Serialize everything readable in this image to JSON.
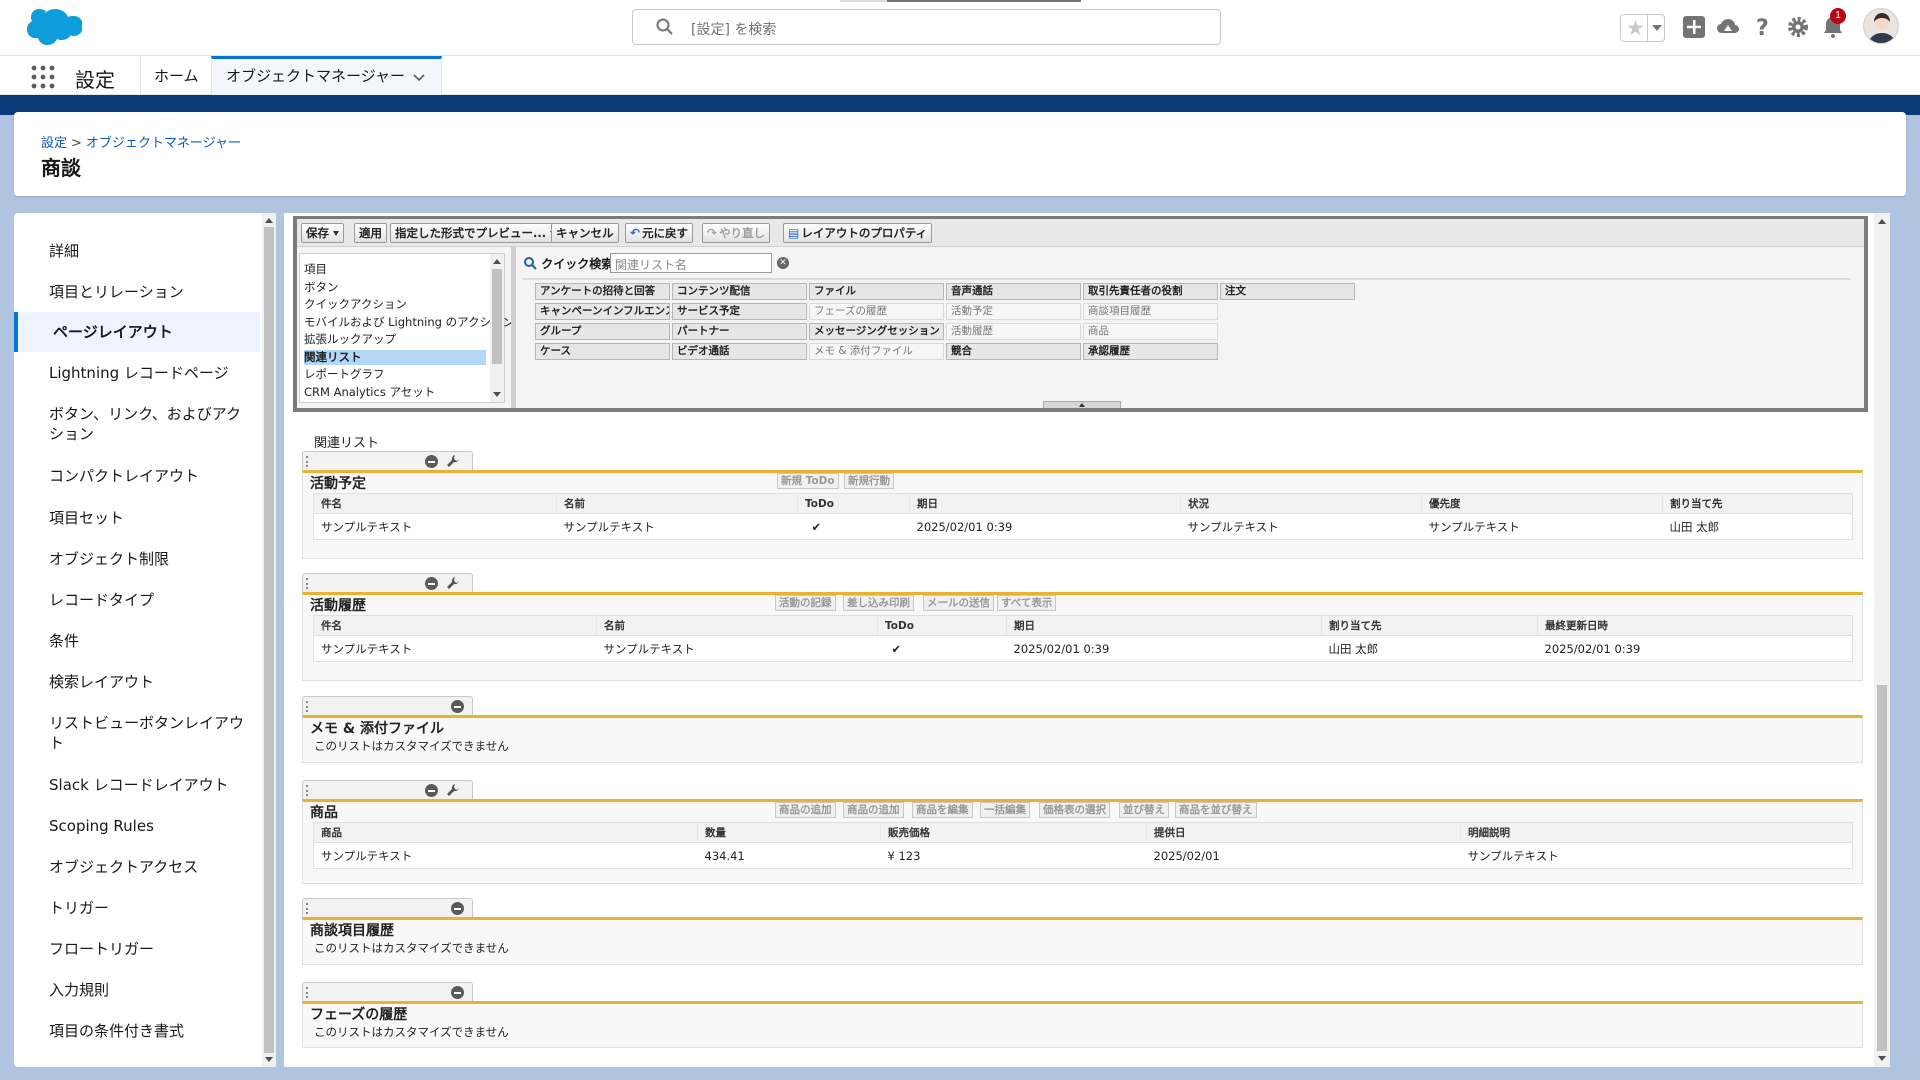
{
  "header": {
    "search_placeholder": "[設定] を検索",
    "notification_count": "1",
    "icons": [
      "favorites-star-icon",
      "favorites-list-icon",
      "global-add-icon",
      "trailhead-icon",
      "help-icon",
      "setup-gear-icon",
      "notifications-bell-icon",
      "user-avatar"
    ]
  },
  "nav": {
    "app_title": "設定",
    "tabs": [
      {
        "label": "ホーム"
      },
      {
        "label": "オブジェクトマネージャー",
        "active": true
      }
    ]
  },
  "page": {
    "breadcrumb": [
      "設定",
      "オブジェクトマネージャー"
    ],
    "breadcrumb_sep": ">",
    "title": "商談"
  },
  "sidebar": {
    "items": [
      {
        "label": "詳細"
      },
      {
        "label": "項目とリレーション"
      },
      {
        "label": "ページレイアウト",
        "active": true
      },
      {
        "label": "Lightning レコードページ"
      },
      {
        "label": "ボタン、リンク、およびアクション"
      },
      {
        "label": "コンパクトレイアウト"
      },
      {
        "label": "項目セット"
      },
      {
        "label": "オブジェクト制限"
      },
      {
        "label": "レコードタイプ"
      },
      {
        "label": "条件"
      },
      {
        "label": "検索レイアウト"
      },
      {
        "label": "リストビューボタンレイアウト"
      },
      {
        "label": "Slack レコードレイアウト"
      },
      {
        "label": "Scoping Rules"
      },
      {
        "label": "オブジェクトアクセス"
      },
      {
        "label": "トリガー"
      },
      {
        "label": "フロートリガー"
      },
      {
        "label": "入力規則"
      },
      {
        "label": "項目の条件付き書式"
      }
    ]
  },
  "toolbar": {
    "save": "保存",
    "apply": "適用",
    "preview": "指定した形式でプレビュー...",
    "cancel": "キャンセル",
    "undo": "元に戻す",
    "redo": "やり直し",
    "layout_props": "レイアウトのプロパティ"
  },
  "palette": {
    "categories": [
      {
        "label": "項目"
      },
      {
        "label": "ボタン"
      },
      {
        "label": "クイックアクション"
      },
      {
        "label": "モバイルおよび Lightning のアクション"
      },
      {
        "label": "拡張ルックアップ"
      },
      {
        "label": "関連リスト",
        "selected": true
      },
      {
        "label": "レポートグラフ"
      },
      {
        "label": "CRM Analytics アセット"
      }
    ],
    "quick_search_label": "クイック検索",
    "quick_search_placeholder": "関連リスト名",
    "fields": [
      [
        {
          "label": "アンケートの招待と回答"
        },
        {
          "label": "コンテンツ配信"
        },
        {
          "label": "ファイル"
        },
        {
          "label": "音声通話"
        },
        {
          "label": "取引先責任者の役割"
        },
        {
          "label": "注文"
        }
      ],
      [
        {
          "label": "キャンペーンインフルエンス"
        },
        {
          "label": "サービス予定"
        },
        {
          "label": "フェーズの履歴",
          "used": true
        },
        {
          "label": "活動予定",
          "used": true
        },
        {
          "label": "商談項目履歴",
          "used": true
        }
      ],
      [
        {
          "label": "グループ"
        },
        {
          "label": "パートナー"
        },
        {
          "label": "メッセージングセッション"
        },
        {
          "label": "活動履歴",
          "used": true
        },
        {
          "label": "商品",
          "used": true
        }
      ],
      [
        {
          "label": "ケース"
        },
        {
          "label": "ビデオ通話"
        },
        {
          "label": "メモ & 添付ファイル",
          "used": true
        },
        {
          "label": "競合"
        },
        {
          "label": "承認履歴"
        }
      ]
    ]
  },
  "layout": {
    "section_heading": "関連リスト",
    "related_lists": [
      {
        "title": "活動予定",
        "buttons": [
          "新規 ToDo",
          "新規行動"
        ],
        "columns": [
          "件名",
          "名前",
          "ToDo",
          "期日",
          "状況",
          "優先度",
          "割り当て先"
        ],
        "rows": [
          [
            "サンプルテキスト",
            "サンプルテキスト",
            "✔",
            "2025/02/01 0:39",
            "サンプルテキスト",
            "サンプルテキスト",
            "山田 太郎"
          ]
        ]
      },
      {
        "title": "活動履歴",
        "buttons": [
          "活動の記録",
          "差し込み印刷",
          "メールの送信",
          "すべて表示"
        ],
        "columns": [
          "件名",
          "名前",
          "ToDo",
          "期日",
          "割り当て先",
          "最終更新日時"
        ],
        "rows": [
          [
            "サンプルテキスト",
            "サンプルテキスト",
            "✔",
            "2025/02/01 0:39",
            "山田 太郎",
            "2025/02/01 0:39"
          ]
        ]
      },
      {
        "title": "メモ & 添付ファイル",
        "note": "このリストはカスタマイズできません"
      },
      {
        "title": "商品",
        "buttons": [
          "商品の追加",
          "商品の追加",
          "商品を編集",
          "一括編集",
          "価格表の選択",
          "並び替え",
          "商品を並び替え"
        ],
        "columns": [
          "商品",
          "数量",
          "販売価格",
          "提供日",
          "明細説明"
        ],
        "rows": [
          [
            "サンプルテキスト",
            "434.41",
            "¥ 123",
            "2025/02/01",
            "サンプルテキスト"
          ]
        ]
      },
      {
        "title": "商談項目履歴",
        "note": "このリストはカスタマイズできません"
      },
      {
        "title": "フェーズの履歴",
        "note": "このリストはカスタマイズできません"
      }
    ]
  },
  "colors": {
    "brand_blue": "#0176d3",
    "section_accent": "#e6b431",
    "band": "#0a3a78"
  }
}
